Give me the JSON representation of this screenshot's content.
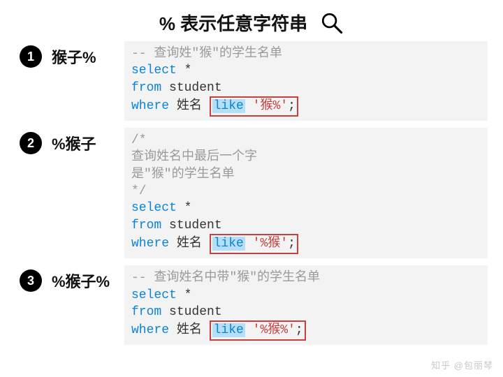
{
  "header": {
    "title": "% 表示任意字符串"
  },
  "examples": [
    {
      "num": "1",
      "pattern": "猴子%",
      "comment_lines": [
        "-- 查询姓\"猴\"的学生名单"
      ],
      "select": "select",
      "star": " *",
      "from": "from",
      "table": " student",
      "where": "where",
      "col": " 姓名 ",
      "like": "like",
      "str": " '猴%'",
      "semi": ";"
    },
    {
      "num": "2",
      "pattern": "%猴子",
      "comment_lines": [
        "/*",
        "查询姓名中最后一个字",
        "是\"猴\"的学生名单",
        "*/"
      ],
      "select": "select",
      "star": " *",
      "from": "from",
      "table": " student",
      "where": "where",
      "col": " 姓名 ",
      "like": "like",
      "str": " '%猴'",
      "semi": ";"
    },
    {
      "num": "3",
      "pattern": "%猴子%",
      "comment_lines": [
        "-- 查询姓名中带\"猴\"的学生名单"
      ],
      "select": "select",
      "star": " *",
      "from": "from",
      "table": " student",
      "where": "where",
      "col": " 姓名 ",
      "like": "like",
      "str": " '%猴%'",
      "semi": ";"
    }
  ],
  "watermark": "知乎 @包丽琴"
}
